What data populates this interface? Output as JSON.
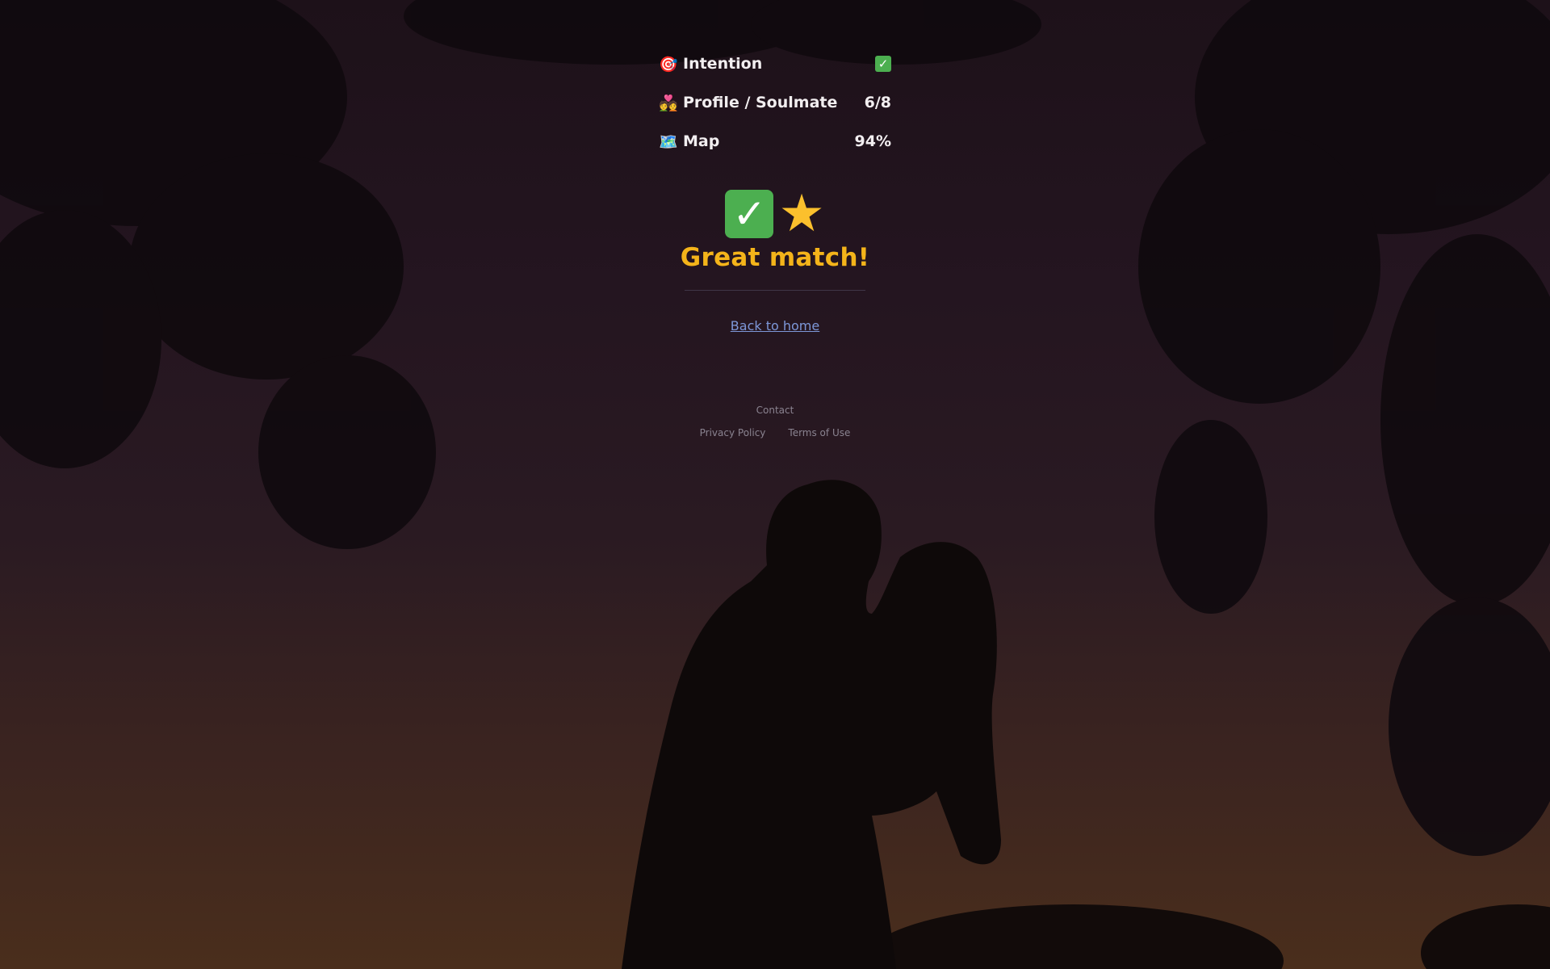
{
  "results": [
    {
      "icon": "target-icon",
      "emoji": "🎯",
      "label": "Intention",
      "value": "✅",
      "value_is_check": true
    },
    {
      "icon": "couple-icon",
      "emoji": "💑",
      "label": "Profile / Soulmate",
      "value": "6/8",
      "value_is_check": false
    },
    {
      "icon": "map-icon",
      "emoji": "🗺️",
      "label": "Map",
      "value": "94%",
      "value_is_check": false
    }
  ],
  "badges": {
    "check": "✓",
    "star": "★"
  },
  "verdict": "Great match!",
  "back_link": "Back to home",
  "footer": {
    "contact": "Contact",
    "privacy": "Privacy Policy",
    "terms": "Terms of Use"
  },
  "colors": {
    "verdict": "#f4b41a",
    "link": "#7d97d8",
    "check_green": "#4caf50"
  }
}
